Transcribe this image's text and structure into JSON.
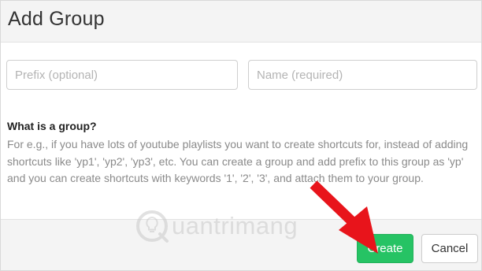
{
  "dialog": {
    "title": "Add Group"
  },
  "form": {
    "prefix_placeholder": "Prefix (optional)",
    "name_placeholder": "Name (required)"
  },
  "info": {
    "heading": "What is a group?",
    "body": "For e.g., if you have lots of youtube playlists you want to create shortcuts for, instead of adding shortcuts like 'yp1', 'yp2', 'yp3', etc. You can create a group and add prefix to this group as 'yp' and you can create shortcuts with keywords '1', '2', '3', and attach them to your group."
  },
  "footer": {
    "create_label": "Create",
    "cancel_label": "Cancel"
  },
  "watermark": {
    "text": "uantrimang",
    "icon": "lightbulb-q-icon"
  },
  "annotation": {
    "icon": "red-arrow-icon",
    "color": "#e8141b"
  },
  "colors": {
    "create_button": "#26c364",
    "header_bg": "#f4f4f4"
  }
}
